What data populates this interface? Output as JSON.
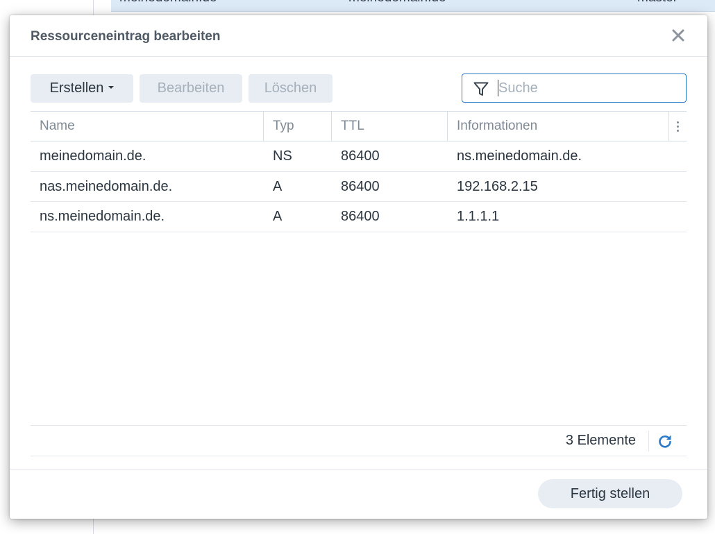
{
  "background": {
    "row_cells": [
      "meinedomain.de",
      "meinedomain.de",
      "master"
    ]
  },
  "dialog": {
    "title": "Ressourceneintrag bearbeiten",
    "close_icon": "close-icon"
  },
  "toolbar": {
    "create_label": "Erstellen",
    "edit_label": "Bearbeiten",
    "delete_label": "Löschen",
    "search_placeholder": "Suche",
    "search_value": ""
  },
  "table": {
    "columns": [
      "Name",
      "Typ",
      "TTL",
      "Informationen"
    ],
    "rows": [
      {
        "name": "meinedomain.de.",
        "typ": "NS",
        "ttl": "86400",
        "info": "ns.meinedomain.de."
      },
      {
        "name": "nas.meinedomain.de.",
        "typ": "A",
        "ttl": "86400",
        "info": "192.168.2.15"
      },
      {
        "name": "ns.meinedomain.de.",
        "typ": "A",
        "ttl": "86400",
        "info": "1.1.1.1"
      }
    ]
  },
  "footer": {
    "count_text": "3 Elemente",
    "done_label": "Fertig stellen"
  },
  "colors": {
    "accent": "#2a78c8",
    "button_bg": "#e8edf3",
    "text": "#2b3640",
    "muted_text": "#808a94"
  }
}
